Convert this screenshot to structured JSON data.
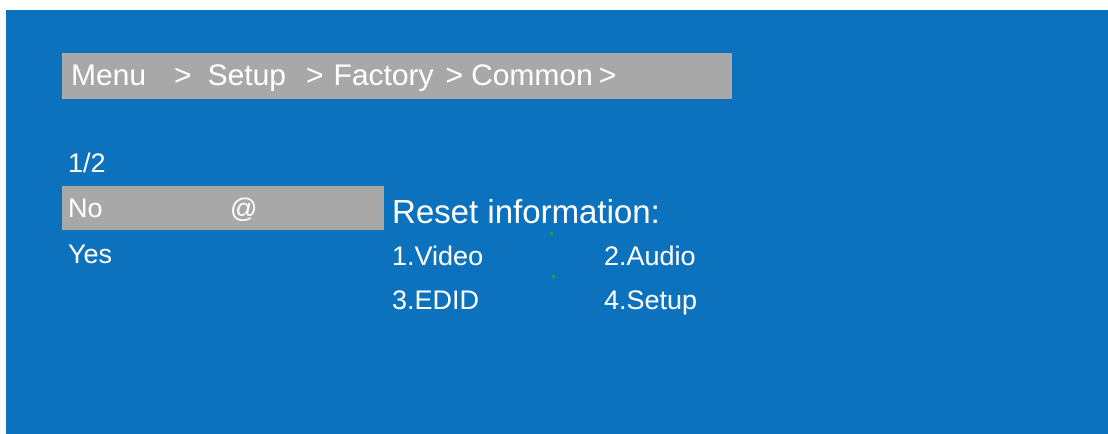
{
  "breadcrumb": {
    "items": [
      "Menu",
      "Setup",
      "Factory",
      "Common"
    ],
    "separator": ">"
  },
  "page_indicator": "1/2",
  "options": [
    {
      "label": "No",
      "marker": "@",
      "selected": true
    },
    {
      "label": "Yes",
      "marker": "",
      "selected": false
    }
  ],
  "reset_info": {
    "title": "Reset information:",
    "items": [
      "1.Video",
      "2.Audio",
      "3.EDID",
      "4.Setup"
    ]
  },
  "colors": {
    "background": "#0d72be",
    "highlight": "#a8a8a8",
    "text": "#ffffff",
    "dot": "#1f9d4a"
  }
}
